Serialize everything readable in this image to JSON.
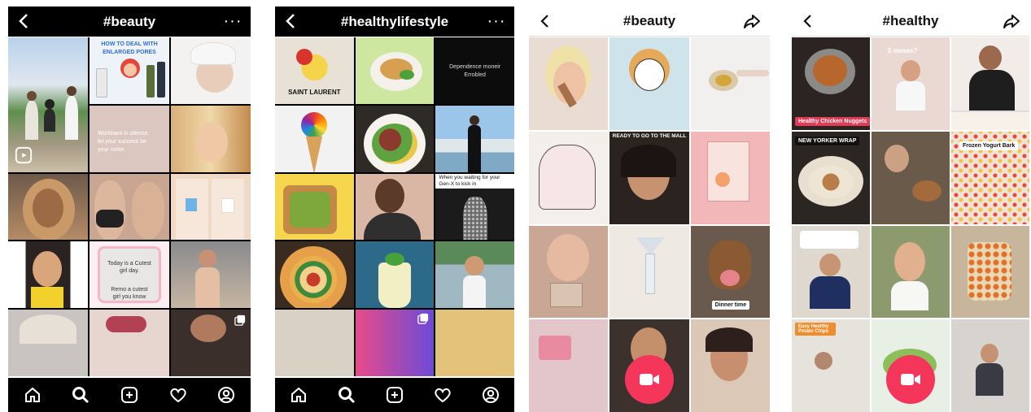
{
  "panels": [
    {
      "title": "#beauty",
      "left_icon": "back-chevron-icon",
      "right_icon": "more-options-icon",
      "theme": "dark"
    },
    {
      "title": "#healthylifestyle",
      "left_icon": "back-chevron-icon",
      "right_icon": "more-options-icon",
      "theme": "dark"
    },
    {
      "title": "#beauty",
      "left_icon": "back-chevron-icon",
      "right_icon": "share-icon",
      "theme": "light"
    },
    {
      "title": "#healthy",
      "left_icon": "back-chevron-icon",
      "right_icon": "share-icon",
      "theme": "light"
    }
  ],
  "p1": {
    "ad_title": "HOW TO DEAL WITH ENLARGED PORES",
    "quote1": "Workhard in silence, let your success be your noise.",
    "quote2_line1": "Today is a Cutest girl day.",
    "quote2_line2": "Remo a cutest girl you know"
  },
  "p2": {
    "quote": "Dependence moneir Errobled",
    "caption": "When you waiting for your Gen-X to kick in",
    "logo_text": "SAINT LAURENT"
  },
  "p3": {
    "meme_caption": "READY TO GO TO THE MALL",
    "tag_dinner": "Dinner time"
  },
  "p4": {
    "tag_nuggets": "Healthy Chicken Nuggets",
    "tag_wrap": "NEW YORKER WRAP",
    "tag_bark": "Frozen Yogurt Bark",
    "tag_potato": "Easy Healthy Potato Chips",
    "meses": "5 meses?"
  },
  "nav_icons": [
    "home-icon",
    "search-icon",
    "add-post-icon",
    "heart-icon",
    "profile-icon"
  ],
  "colors": {
    "accent_record": "#f3365a",
    "tag_red": "#e33a55"
  }
}
